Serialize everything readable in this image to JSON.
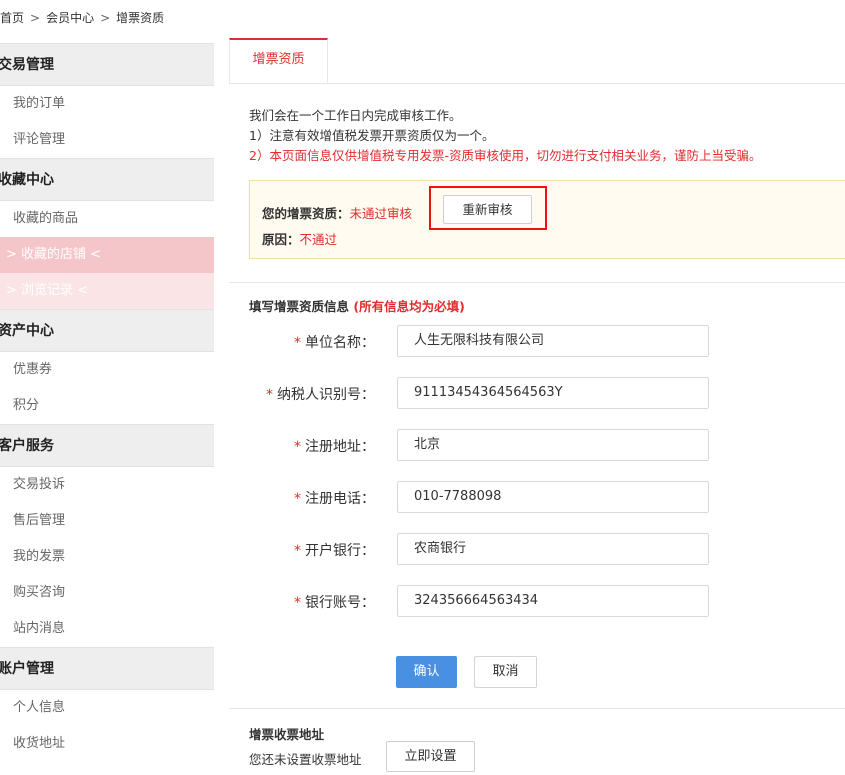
{
  "breadcrumb": {
    "home": "首页",
    "sep1": ">",
    "member": "会员中心",
    "sep2": ">",
    "current": "增票资质"
  },
  "sidebar": {
    "groups": [
      {
        "title": "交易管理",
        "items": [
          "我的订单",
          "评论管理"
        ]
      },
      {
        "title": "收藏中心",
        "items": [
          "收藏的商品",
          "> 收藏的店铺 <",
          "> 浏览记录 <"
        ]
      },
      {
        "title": "资产中心",
        "items": [
          "优惠券",
          "积分"
        ]
      },
      {
        "title": "客户服务",
        "items": [
          "交易投诉",
          "售后管理",
          "我的发票",
          "购买咨询",
          "站内消息"
        ]
      },
      {
        "title": "账户管理",
        "items": [
          "个人信息",
          "收货地址"
        ]
      }
    ]
  },
  "tab": {
    "label": "增票资质"
  },
  "notice": {
    "line1": "我们会在一个工作日内完成审核工作。",
    "line2": "1）注意有效增值税发票开票资质仅为一个。",
    "line3": "2）本页面信息仅供增值税专用发票-资质审核使用，切勿进行支付相关业务，谨防上当受骗。"
  },
  "status": {
    "label": "您的增票资质：",
    "value": "未通过审核",
    "reason_label": "原因：",
    "reason_value": "不通过",
    "recheck_button": "重新审核"
  },
  "form": {
    "title": "填写增票资质信息",
    "required_note": "(所有信息均为必填)",
    "star": "*",
    "fields": [
      {
        "label": "单位名称：",
        "value": "人生无限科技有限公司"
      },
      {
        "label": "纳税人识别号：",
        "value": "91113454364564563Y"
      },
      {
        "label": "注册地址：",
        "value": "北京"
      },
      {
        "label": "注册电话：",
        "value": "010-7788098"
      },
      {
        "label": "开户银行：",
        "value": "农商银行"
      },
      {
        "label": "银行账号：",
        "value": "324356664563434"
      }
    ],
    "confirm": "确认",
    "cancel": "取消"
  },
  "address": {
    "title": "增票收票地址",
    "text": "您还未设置收票地址",
    "set_button": "立即设置"
  },
  "colors": {
    "accent": "#e12d2d",
    "primary_button": "#4a90e2",
    "sidebar_active": "#f5c6c9"
  }
}
